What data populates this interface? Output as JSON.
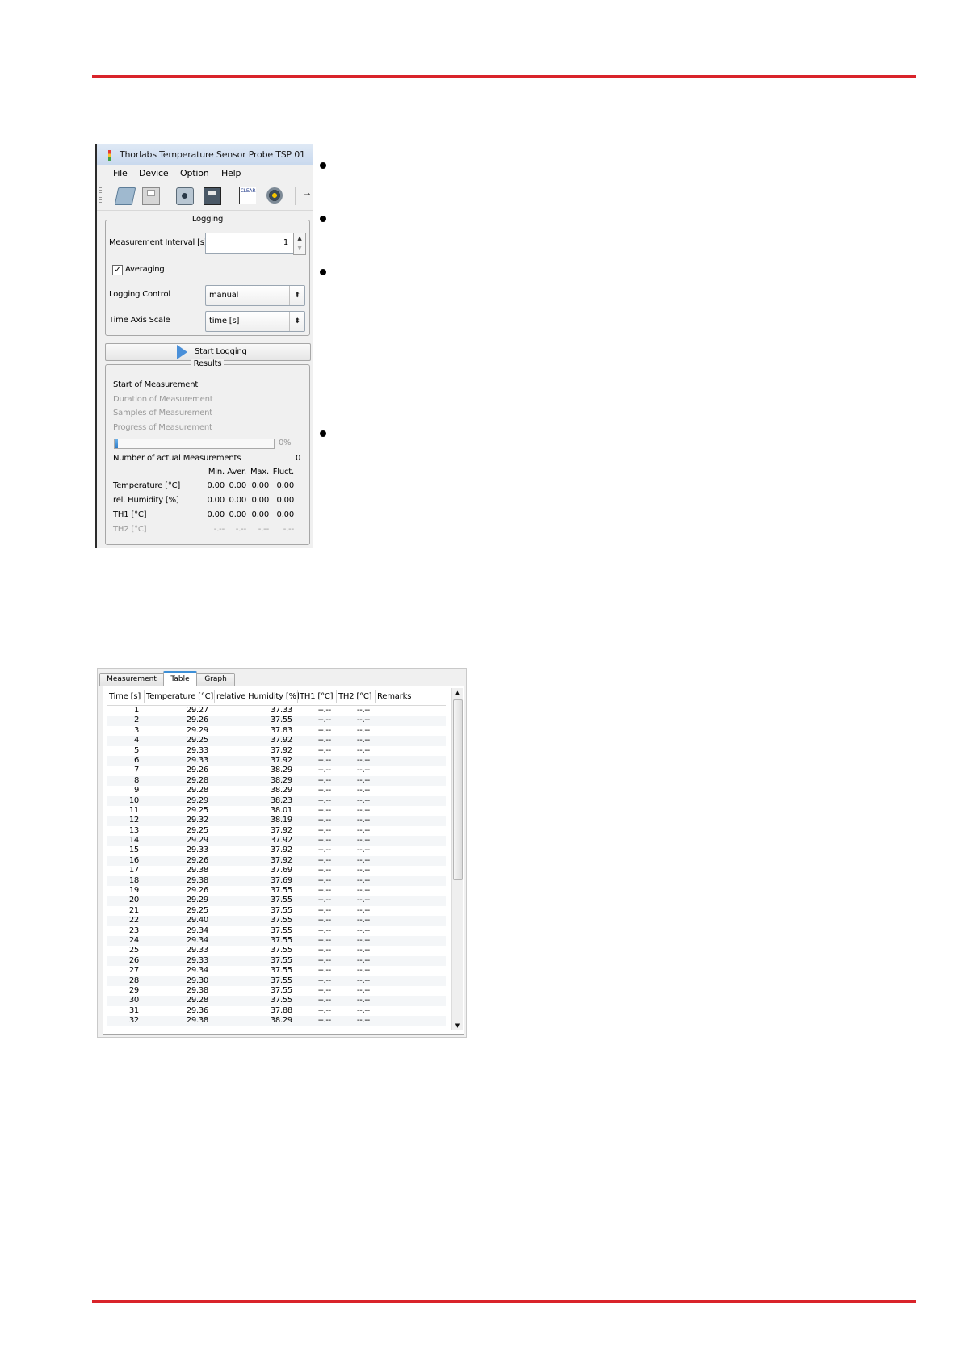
{
  "window": {
    "title": "Thorlabs Temperature Sensor Probe TSP 01",
    "menu": [
      "File",
      "Device",
      "Option",
      "Help"
    ],
    "toolbar_icons": [
      "open-folder-icon",
      "save-icon",
      "open-picture-icon",
      "save-data-icon",
      "clear-graph-icon",
      "settings-gear-icon"
    ]
  },
  "logging": {
    "group_title": "Logging",
    "interval_label": "Measurement Interval [s]",
    "interval_value": "1",
    "averaging_label": "Averaging",
    "averaging_checked": true,
    "check_mark": "✓",
    "logging_control_label": "Logging Control",
    "logging_control_value": "manual",
    "time_axis_label": "Time Axis Scale",
    "time_axis_value": "time [s]",
    "start_label": "Start Logging"
  },
  "results": {
    "group_title": "Results",
    "start_of_measurement": "Start of Measurement",
    "duration": "Duration of Measurement",
    "samples": "Samples of Measurement",
    "progress_label": "Progress of Measurement",
    "progress_fraction": 0.02,
    "progress_text": "0%",
    "actual_label": "Number of actual Measurements",
    "actual_value": "0",
    "stat_headers": [
      "Min.",
      "Aver.",
      "Max.",
      "Fluct."
    ],
    "stats": [
      {
        "label": "Temperature [°C]",
        "values": [
          "0.00",
          "0.00",
          "0.00",
          "0.00"
        ],
        "enabled": true
      },
      {
        "label": "rel. Humidity [%]",
        "values": [
          "0.00",
          "0.00",
          "0.00",
          "0.00"
        ],
        "enabled": true
      },
      {
        "label": "TH1 [°C]",
        "values": [
          "0.00",
          "0.00",
          "0.00",
          "0.00"
        ],
        "enabled": true
      },
      {
        "label": "TH2 [°C]",
        "values": [
          "-.--",
          "-.--",
          "-.--",
          "-.--"
        ],
        "enabled": false
      }
    ]
  },
  "table_window": {
    "tabs": [
      "Measurement",
      "Table",
      "Graph"
    ],
    "active_tab": "Table",
    "headers": [
      "Time [s]",
      "Temperature [°C]",
      "relative Humidity [%]",
      "TH1 [°C]",
      "TH2 [°C]",
      "Remarks"
    ],
    "rows": [
      [
        "1",
        "29.27",
        "37.33",
        "--.--",
        "--.--"
      ],
      [
        "2",
        "29.26",
        "37.55",
        "--.--",
        "--.--"
      ],
      [
        "3",
        "29.29",
        "37.83",
        "--.--",
        "--.--"
      ],
      [
        "4",
        "29.25",
        "37.92",
        "--.--",
        "--.--"
      ],
      [
        "5",
        "29.33",
        "37.92",
        "--.--",
        "--.--"
      ],
      [
        "6",
        "29.33",
        "37.92",
        "--.--",
        "--.--"
      ],
      [
        "7",
        "29.26",
        "38.29",
        "--.--",
        "--.--"
      ],
      [
        "8",
        "29.28",
        "38.29",
        "--.--",
        "--.--"
      ],
      [
        "9",
        "29.28",
        "38.29",
        "--.--",
        "--.--"
      ],
      [
        "10",
        "29.29",
        "38.23",
        "--.--",
        "--.--"
      ],
      [
        "11",
        "29.25",
        "38.01",
        "--.--",
        "--.--"
      ],
      [
        "12",
        "29.32",
        "38.19",
        "--.--",
        "--.--"
      ],
      [
        "13",
        "29.25",
        "37.92",
        "--.--",
        "--.--"
      ],
      [
        "14",
        "29.29",
        "37.92",
        "--.--",
        "--.--"
      ],
      [
        "15",
        "29.33",
        "37.92",
        "--.--",
        "--.--"
      ],
      [
        "16",
        "29.26",
        "37.92",
        "--.--",
        "--.--"
      ],
      [
        "17",
        "29.38",
        "37.69",
        "--.--",
        "--.--"
      ],
      [
        "18",
        "29.38",
        "37.69",
        "--.--",
        "--.--"
      ],
      [
        "19",
        "29.26",
        "37.55",
        "--.--",
        "--.--"
      ],
      [
        "20",
        "29.29",
        "37.55",
        "--.--",
        "--.--"
      ],
      [
        "21",
        "29.25",
        "37.55",
        "--.--",
        "--.--"
      ],
      [
        "22",
        "29.40",
        "37.55",
        "--.--",
        "--.--"
      ],
      [
        "23",
        "29.34",
        "37.55",
        "--.--",
        "--.--"
      ],
      [
        "24",
        "29.34",
        "37.55",
        "--.--",
        "--.--"
      ],
      [
        "25",
        "29.33",
        "37.55",
        "--.--",
        "--.--"
      ],
      [
        "26",
        "29.33",
        "37.55",
        "--.--",
        "--.--"
      ],
      [
        "27",
        "29.34",
        "37.55",
        "--.--",
        "--.--"
      ],
      [
        "28",
        "29.30",
        "37.55",
        "--.--",
        "--.--"
      ],
      [
        "29",
        "29.38",
        "37.55",
        "--.--",
        "--.--"
      ],
      [
        "30",
        "29.28",
        "37.55",
        "--.--",
        "--.--"
      ],
      [
        "31",
        "29.36",
        "37.88",
        "--.--",
        "--.--"
      ],
      [
        "32",
        "29.38",
        "38.29",
        "--.--",
        "--.--"
      ]
    ],
    "scroll_up": "▲",
    "scroll_down": "▼"
  },
  "colors": {
    "accent_rule": "#d9232a",
    "progress_fill": "#2d7cc7",
    "active_tab": "#3c8fd7"
  }
}
